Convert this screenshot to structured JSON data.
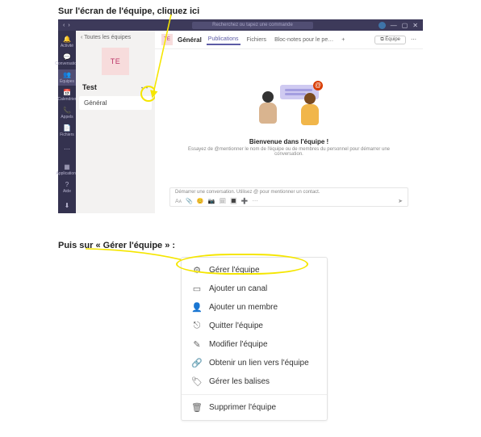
{
  "captions": {
    "first": "Sur l'écran de l'équipe, cliquez ici",
    "second": "Puis sur « Gérer l'équipe » :"
  },
  "titlebar": {
    "search_placeholder": "Recherchez ou tapez une commande",
    "window_min": "—",
    "window_max": "▢",
    "window_close": "✕",
    "back": "‹",
    "fwd": "›"
  },
  "rail": {
    "items": [
      {
        "icon": "🔔",
        "label": "Activité"
      },
      {
        "icon": "💬",
        "label": "Conversation"
      },
      {
        "icon": "👥",
        "label": "Équipes"
      },
      {
        "icon": "📅",
        "label": "Calendrier"
      },
      {
        "icon": "📞",
        "label": "Appels"
      },
      {
        "icon": "📄",
        "label": "Fichiers"
      },
      {
        "icon": "⋯",
        "label": ""
      }
    ],
    "bottom": [
      {
        "icon": "▦",
        "label": "Applications"
      },
      {
        "icon": "?",
        "label": "Aide"
      },
      {
        "icon": "⬇",
        "label": ""
      }
    ]
  },
  "left_panel": {
    "back_label": "‹  Toutes les équipes",
    "tile_initials": "TE",
    "team_name": "Test",
    "more": "⋯",
    "channel": "Général"
  },
  "main": {
    "tile_initials": "TE",
    "channel_name": "Général",
    "tabs": [
      "Publications",
      "Fichiers",
      "Bloc-notes pour le pe…"
    ],
    "tab_plus": "+",
    "join_label": "⧉ Équipe",
    "header_more": "⋯",
    "welcome_title": "Bienvenue dans l'équipe !",
    "welcome_sub": "Essayez de @mentionner le nom de l'équipe ou de membres du personnel pour démarrer une conversation.",
    "composer_placeholder": "Démarrer une conversation. Utilisez @ pour mentionner un contact.",
    "composer_icons": [
      "Aᴀ",
      "📎",
      "😊",
      "📷",
      "🗓",
      "🔳",
      "➕",
      "⋯"
    ],
    "send": "➤",
    "at_glyph": "@"
  },
  "menu": {
    "items": [
      {
        "icon": "⚙",
        "label": "Gérer l'équipe"
      },
      {
        "icon": "▭",
        "label": "Ajouter un canal"
      },
      {
        "icon": "👤",
        "label": "Ajouter un membre"
      },
      {
        "icon": "⎋",
        "label": "Quitter l'équipe"
      },
      {
        "icon": "✎",
        "label": "Modifier l'équipe"
      },
      {
        "icon": "🔗",
        "label": "Obtenir un lien vers l'équipe"
      },
      {
        "icon": "🏷",
        "label": "Gérer les balises"
      }
    ],
    "delete": {
      "icon": "🗑",
      "label": "Supprimer l'équipe"
    }
  }
}
